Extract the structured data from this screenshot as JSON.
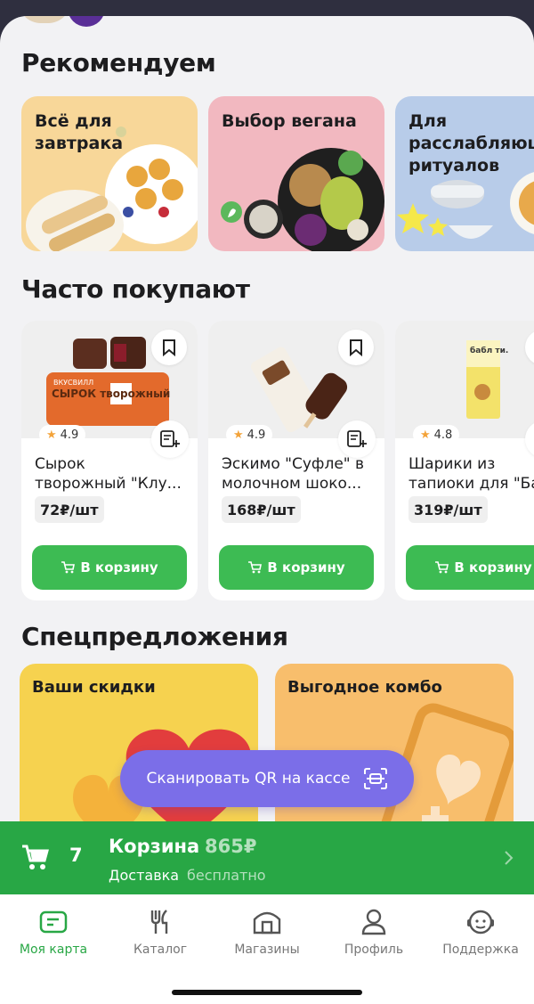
{
  "colors": {
    "brand_green": "#3dbb53",
    "cart_bar": "#28a745",
    "qr_purple": "#7b6ee8"
  },
  "recommend": {
    "title": "Рекомендуем",
    "cards": [
      {
        "label": "Всё для\nзавтрака"
      },
      {
        "label": "Выбор вегана"
      },
      {
        "label": "Для\nрасслабляющих\nритуалов"
      }
    ]
  },
  "frequent": {
    "title": "Часто покупают",
    "products": [
      {
        "rating": "4.9",
        "name_line1": "Сырок",
        "name_line2": "творожный \"Клу...",
        "price": "72₽/шт",
        "cart_label": "В корзину",
        "pack_text": "СЫРОК творожный",
        "pack_brand": "ВКУСВИЛЛ"
      },
      {
        "rating": "4.9",
        "name_line1": "Эскимо \"Суфле\" в",
        "name_line2": "молочном шоко...",
        "price": "168₽/шт",
        "cart_label": "В корзину"
      },
      {
        "rating": "4.8",
        "name_line1": "Шарики из",
        "name_line2": "тапиоки для \"Ба",
        "price": "319₽/шт",
        "cart_label": "В корзину",
        "pack_text": "бабл ти."
      }
    ]
  },
  "specials": {
    "title": "Спецпредложения",
    "cards": [
      {
        "label": "Ваши скидки"
      },
      {
        "label": "Выгодное комбо"
      }
    ]
  },
  "qr_button": {
    "label": "Сканировать QR на кассе"
  },
  "cart": {
    "count": "7",
    "title": "Корзина",
    "sum": "865₽",
    "delivery_label": "Доставка",
    "delivery_value": "бесплатно"
  },
  "tabs": [
    {
      "label": "Моя карта",
      "icon": "card-icon",
      "active": true
    },
    {
      "label": "Каталог",
      "icon": "cutlery-icon"
    },
    {
      "label": "Магазины",
      "icon": "store-icon"
    },
    {
      "label": "Профиль",
      "icon": "profile-icon"
    },
    {
      "label": "Поддержка",
      "icon": "support-icon"
    }
  ]
}
